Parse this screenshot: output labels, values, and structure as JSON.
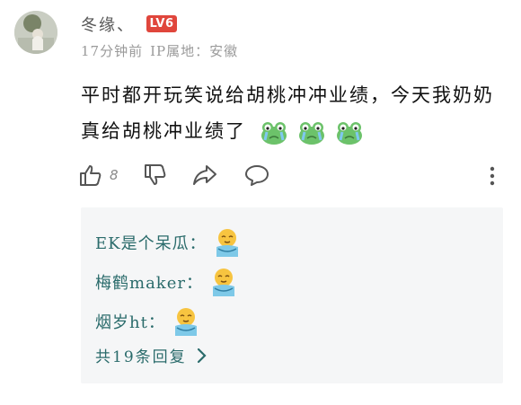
{
  "user": {
    "name": "冬缘、",
    "level_badge": "LV6",
    "time": "17分钟前",
    "ip_location": "IP属地：安徽"
  },
  "post": {
    "text": "平时都开玩笑说给胡桃冲冲业绩，今天我奶奶真给胡桃冲业绩了",
    "emojis": [
      "crying-frog-emoji",
      "crying-frog-emoji",
      "crying-frog-emoji"
    ]
  },
  "actions": {
    "like_count": "8",
    "icons": [
      "thumbs-up-icon",
      "thumbs-down-icon",
      "share-icon",
      "comment-icon",
      "more-vertical-icon"
    ]
  },
  "replies": {
    "items": [
      {
        "author": "EK是个呆瓜：",
        "emoji": "hug-emoji"
      },
      {
        "author": "梅鹤maker：",
        "emoji": "hug-emoji"
      },
      {
        "author": "烟岁ht：",
        "emoji": "hug-emoji"
      }
    ],
    "more_label": "共19条回复"
  },
  "colors": {
    "badge": "#e0463c",
    "reply_text": "#2a6b6b",
    "reply_bg": "#f5f6f7"
  }
}
